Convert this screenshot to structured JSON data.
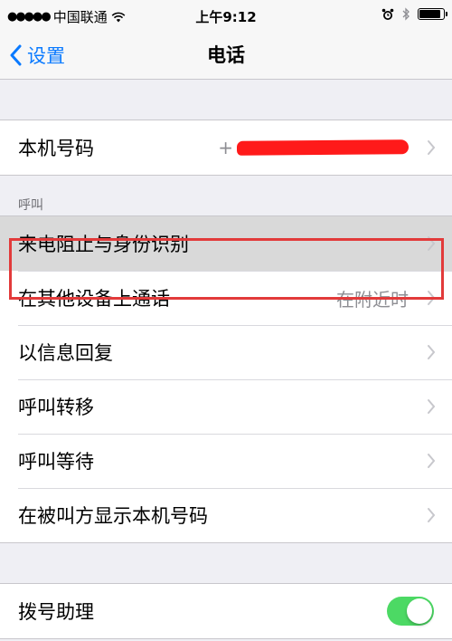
{
  "status_bar": {
    "signal": "●●●●●",
    "carrier": "中国联通",
    "time": "上午9:12"
  },
  "nav": {
    "back_label": "设置",
    "title": "电话"
  },
  "my_number": {
    "label": "本机号码",
    "value_prefix": "+"
  },
  "calls_section": {
    "header": "呼叫",
    "rows": [
      {
        "label": "来电阻止与身份识别",
        "detail": ""
      },
      {
        "label": "在其他设备上通话",
        "detail": "在附近时"
      },
      {
        "label": "以信息回复",
        "detail": ""
      },
      {
        "label": "呼叫转移",
        "detail": ""
      },
      {
        "label": "呼叫等待",
        "detail": ""
      },
      {
        "label": "在被叫方显示本机号码",
        "detail": ""
      }
    ]
  },
  "dial_assist": {
    "label": "拨号助理",
    "enabled": true
  },
  "colors": {
    "accent": "#0a7aff",
    "toggle_on": "#4cd964",
    "highlight_border": "#e23a3a",
    "redaction": "#ff1a1a"
  }
}
